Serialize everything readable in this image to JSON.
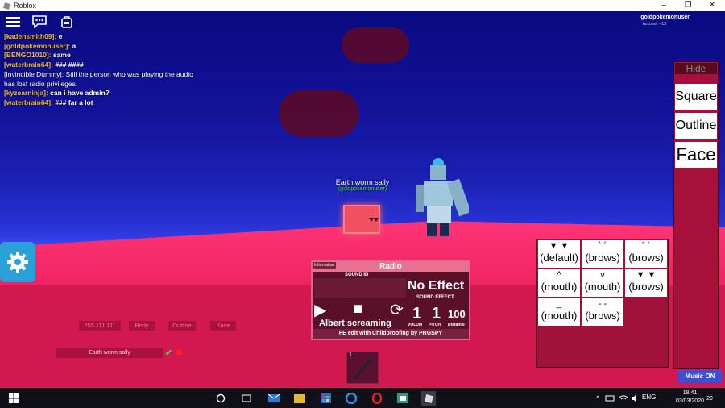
{
  "window": {
    "title": "Roblox",
    "minimize": "–",
    "maximize": "❐",
    "close": "✕"
  },
  "topbar": {
    "account_name": "goldpokemonuser",
    "account_sub": "Account: <13"
  },
  "chat": [
    {
      "name": "[kadensmith09]:",
      "msg": "e"
    },
    {
      "name": "[goldpokemonuser]:",
      "msg": "a"
    },
    {
      "name": "[BENGO1010]:",
      "msg": "same"
    },
    {
      "name": "[waterbrain64]:",
      "msg": "### ####"
    },
    {
      "name": "[Invincible Dummy]:",
      "msg": "Still the person who was playing the audio has lost radio privileges.",
      "system": true
    },
    {
      "name": "[kyzearninja]:",
      "msg": "can i have admin?"
    },
    {
      "name": "[waterbrain64]:",
      "msg": "### far a lot"
    }
  ],
  "cube_tag": {
    "name": "Earth worm sally",
    "user": "(goldpokemonuser)"
  },
  "radio": {
    "info_label": "Information",
    "title": "Radio",
    "sound_id_label": "SOUND ID",
    "effect": "No Effect",
    "effect_label": "SOUND EFFECT",
    "play": "▶",
    "stop": "■",
    "loop": "⟳",
    "song": "Albert screaming",
    "volume": "1",
    "volume_label": "VOLUM",
    "pitch": "1",
    "pitch_label": "PITCH",
    "distance": "100",
    "distance_label": "Distance",
    "footer": "FE edit with Childproofing by PRGSPY"
  },
  "color_editor": {
    "rgb": "255 111 111",
    "body": "Body",
    "outline": "Outline",
    "face": "Face",
    "name_value": "Earth worm sally",
    "confirm": "✔",
    "cancel": "✖"
  },
  "hotbar": {
    "slot_number": "1"
  },
  "right_menu": {
    "hide": "Hide",
    "square": "Square",
    "outline": "Outline",
    "face": "Face"
  },
  "faces": [
    {
      "top": "▼ ▼",
      "bottom": "(default)"
    },
    {
      "top": "` ´",
      "bottom": "(brows)"
    },
    {
      "top": "´ `",
      "bottom": "(brows)"
    },
    {
      "top": "^",
      "bottom": "(mouth)"
    },
    {
      "top": "v",
      "bottom": "(mouth)"
    },
    {
      "top": "▼ ▼",
      "bottom": "(brows)"
    },
    {
      "top": "_",
      "bottom": "(mouth)"
    },
    {
      "top": "- -",
      "bottom": "(brows)"
    }
  ],
  "music_button": "Music ON",
  "taskbar": {
    "language": "ENG",
    "time": "18:41",
    "date": "03/03/2020",
    "notifications": "29"
  },
  "colors": {
    "accent": "#ff2a6e",
    "panel": "#a0123c",
    "chat_name": "#f2b63c"
  }
}
